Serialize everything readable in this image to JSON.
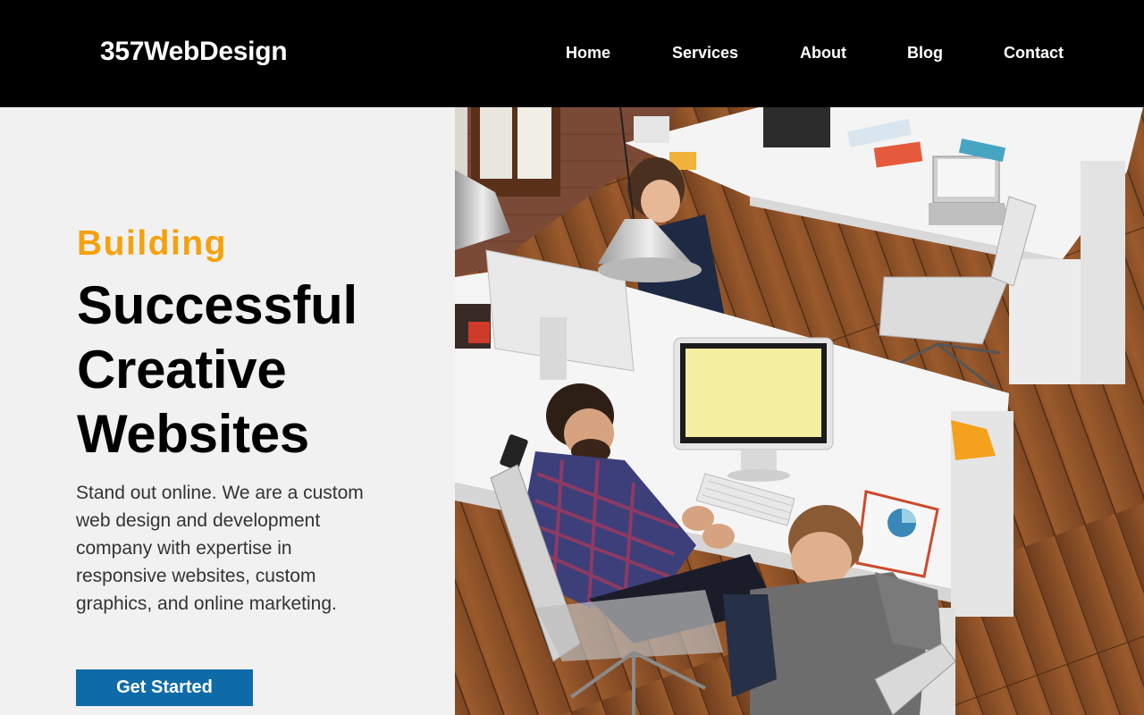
{
  "header": {
    "logo": "357WebDesign",
    "nav": [
      {
        "label": "Home"
      },
      {
        "label": "Services"
      },
      {
        "label": "About"
      },
      {
        "label": "Blog"
      },
      {
        "label": "Contact"
      }
    ]
  },
  "hero": {
    "kicker": "Building",
    "headline_lines": [
      "Successful",
      "Creative",
      "Websites"
    ],
    "intro": "Stand out online. We are a custom web design and development company with expertise in responsive websites, custom graphics, and online marketing.",
    "cta_label": "Get Started",
    "image_icon": "office-photo-icon"
  },
  "colors": {
    "header_bg": "#000000",
    "kicker": "#f6a10b",
    "cta_bg": "#0e6ba8",
    "panel_bg": "#f1f1f1"
  }
}
